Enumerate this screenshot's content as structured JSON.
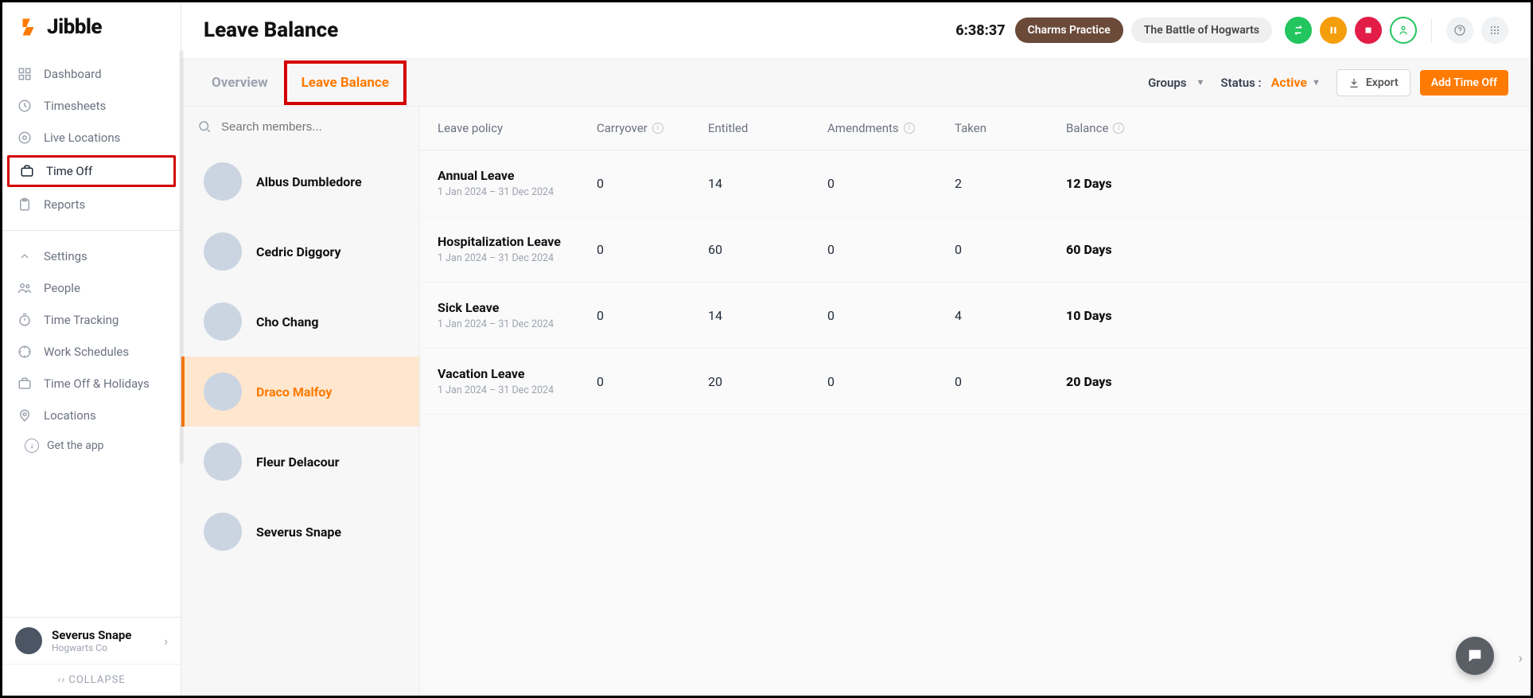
{
  "brand": "Jibble",
  "sidebar": {
    "items": [
      {
        "label": "Dashboard",
        "icon": "dashboard"
      },
      {
        "label": "Timesheets",
        "icon": "clock"
      },
      {
        "label": "Live Locations",
        "icon": "location"
      },
      {
        "label": "Time Off",
        "icon": "briefcase",
        "highlighted": true
      },
      {
        "label": "Reports",
        "icon": "clipboard"
      }
    ],
    "settings": [
      {
        "label": "Settings",
        "icon": "chevron-up"
      },
      {
        "label": "People",
        "icon": "people"
      },
      {
        "label": "Time Tracking",
        "icon": "timer"
      },
      {
        "label": "Work Schedules",
        "icon": "schedule"
      },
      {
        "label": "Time Off & Holidays",
        "icon": "briefcase"
      },
      {
        "label": "Locations",
        "icon": "pin"
      }
    ],
    "get_app": "Get the app",
    "user": {
      "name": "Severus Snape",
      "company": "Hogwarts Co"
    },
    "collapse": "COLLAPSE"
  },
  "header": {
    "title": "Leave Balance",
    "clock": "6:38:37",
    "pills": [
      {
        "label": "Charms Practice",
        "style": "brown"
      },
      {
        "label": "The Battle of Hogwarts",
        "style": "gray"
      }
    ]
  },
  "subheader": {
    "tabs": [
      {
        "label": "Overview",
        "active": false
      },
      {
        "label": "Leave Balance",
        "active": true
      }
    ],
    "groups_label": "Groups",
    "status_label": "Status :",
    "status_value": "Active",
    "export_label": "Export",
    "add_label": "Add Time Off"
  },
  "search_placeholder": "Search members...",
  "members": [
    {
      "name": "Albus Dumbledore",
      "avatar": "av1"
    },
    {
      "name": "Cedric Diggory",
      "avatar": "av2"
    },
    {
      "name": "Cho Chang",
      "avatar": "av3"
    },
    {
      "name": "Draco Malfoy",
      "avatar": "av4",
      "selected": true
    },
    {
      "name": "Fleur Delacour",
      "avatar": "av5"
    },
    {
      "name": "Severus Snape",
      "avatar": "av6"
    }
  ],
  "table": {
    "columns": [
      "Leave policy",
      "Carryover",
      "Entitled",
      "Amendments",
      "Taken",
      "Balance"
    ],
    "rows": [
      {
        "policy": "Annual Leave",
        "range": "1 Jan 2024 – 31 Dec 2024",
        "carryover": "0",
        "entitled": "14",
        "amendments": "0",
        "taken": "2",
        "balance": "12 Days"
      },
      {
        "policy": "Hospitalization Leave",
        "range": "1 Jan 2024 – 31 Dec 2024",
        "carryover": "0",
        "entitled": "60",
        "amendments": "0",
        "taken": "0",
        "balance": "60 Days"
      },
      {
        "policy": "Sick Leave",
        "range": "1 Jan 2024 – 31 Dec 2024",
        "carryover": "0",
        "entitled": "14",
        "amendments": "0",
        "taken": "4",
        "balance": "10 Days"
      },
      {
        "policy": "Vacation Leave",
        "range": "1 Jan 2024 – 31 Dec 2024",
        "carryover": "0",
        "entitled": "20",
        "amendments": "0",
        "taken": "0",
        "balance": "20 Days"
      }
    ]
  }
}
